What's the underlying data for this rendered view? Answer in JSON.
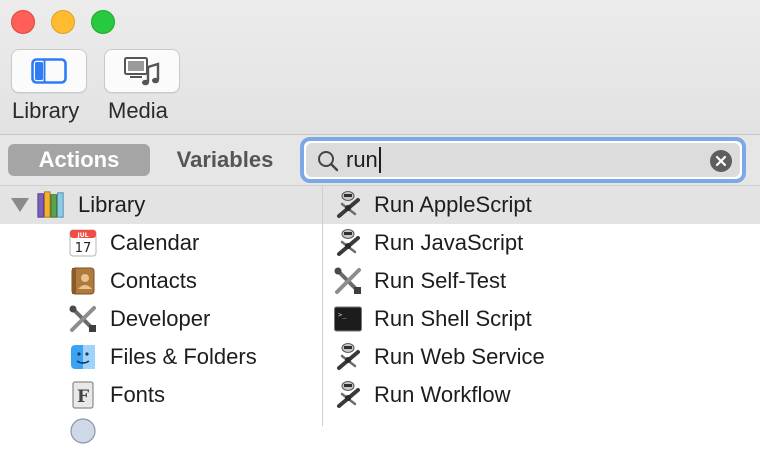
{
  "toolbar": {
    "library_label": "Library",
    "media_label": "Media"
  },
  "filter": {
    "actions_label": "Actions",
    "variables_label": "Variables",
    "search_value": "run"
  },
  "library_tree": {
    "root_label": "Library",
    "items": [
      {
        "label": "Calendar",
        "icon": "calendar-icon",
        "calendar_month": "JUL",
        "calendar_day": "17"
      },
      {
        "label": "Contacts",
        "icon": "contacts-icon"
      },
      {
        "label": "Developer",
        "icon": "developer-tools-icon"
      },
      {
        "label": "Files & Folders",
        "icon": "finder-icon"
      },
      {
        "label": "Fonts",
        "icon": "fonts-icon",
        "glyph": "F"
      }
    ]
  },
  "results": [
    {
      "label": "Run AppleScript",
      "icon": "automator-robot-icon",
      "selected": true
    },
    {
      "label": "Run JavaScript",
      "icon": "automator-robot-icon"
    },
    {
      "label": "Run Self-Test",
      "icon": "developer-tools-icon"
    },
    {
      "label": "Run Shell Script",
      "icon": "terminal-icon",
      "terminal_prompt": ">_"
    },
    {
      "label": "Run Web Service",
      "icon": "automator-robot-icon"
    },
    {
      "label": "Run Workflow",
      "icon": "automator-robot-icon"
    }
  ],
  "colors": {
    "accent": "#3a82f6",
    "search_focus_ring": "#7ea7e6",
    "selected_segment": "#a5a5a5"
  }
}
